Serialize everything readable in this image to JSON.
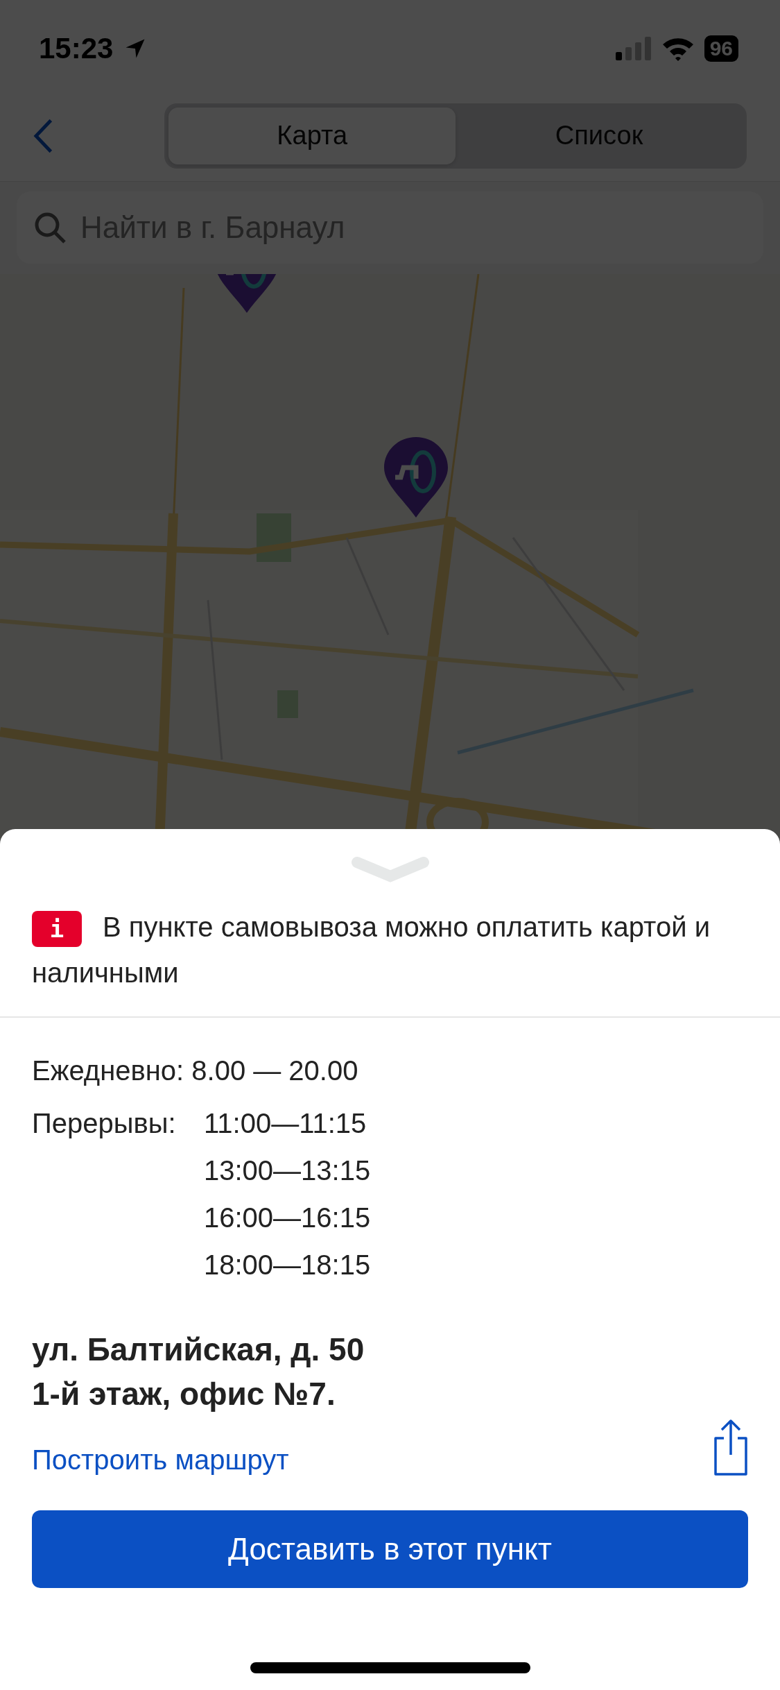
{
  "status_bar": {
    "time": "15:23",
    "battery": "96"
  },
  "nav": {
    "tabs": [
      {
        "label": "Карта",
        "selected": true
      },
      {
        "label": "Список",
        "selected": false
      }
    ]
  },
  "search": {
    "placeholder": "Найти в г. Барнаул"
  },
  "sheet": {
    "notice_icon": "i",
    "notice": "В пункте самовывоза можно оплатить картой и наличными",
    "hours": "Ежедневно: 8.00 — 20.00",
    "breaks_label": "Перерывы:",
    "breaks": [
      "11:00—11:15",
      "13:00—13:15",
      "16:00—16:15",
      "18:00—18:15"
    ],
    "address": [
      "ул. Балтийская, д. 50",
      "1-й этаж, офис №7."
    ],
    "route_link": "Построить маршрут",
    "primary_button": "Доставить в этот пункт"
  }
}
